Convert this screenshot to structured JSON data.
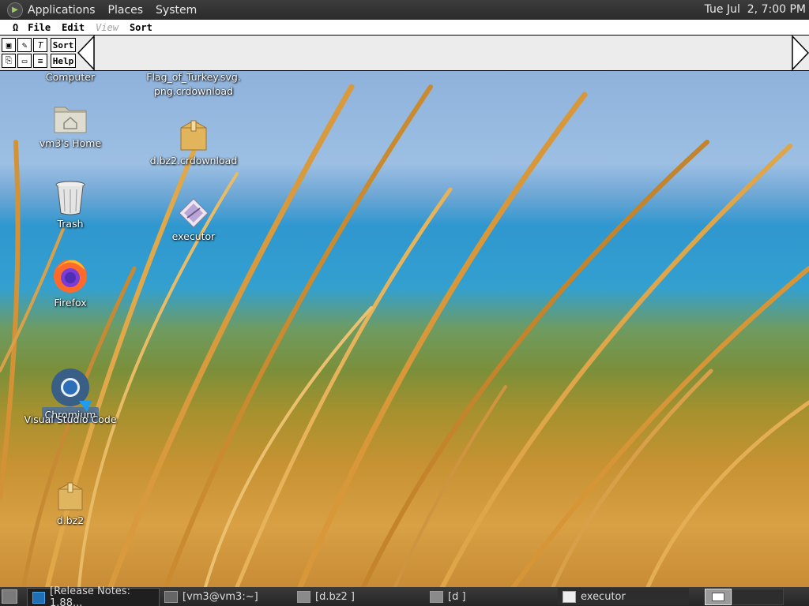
{
  "top_panel": {
    "menus": [
      "Applications",
      "Places",
      "System"
    ],
    "clock": "Tue Jul  2, 7:00 PM"
  },
  "app_menubar": {
    "items": [
      "Ω",
      "File",
      "Edit",
      "View",
      "Sort"
    ],
    "disabled": "View"
  },
  "toolstrip": {
    "sort_label": "Sort",
    "help_label": "Help"
  },
  "desktop": {
    "icons": [
      {
        "label": "Computer",
        "icon": "computer-icon"
      },
      {
        "label": "vm3's Home",
        "icon": "home-folder-icon"
      },
      {
        "label": "Trash",
        "icon": "trash-icon"
      },
      {
        "label": "Firefox",
        "icon": "firefox-icon"
      },
      {
        "label": "Chromium",
        "icon": "chromium-icon"
      },
      {
        "label": "Visual Studio Code",
        "icon": "vscode-icon"
      },
      {
        "label": "d.bz2",
        "icon": "archive-icon"
      },
      {
        "label": "Flag_of_Turkey.svg.",
        "label2": "png.crdownload",
        "icon": "file-icon"
      },
      {
        "label": "d.bz2.crdownload",
        "icon": "archive-icon"
      },
      {
        "label": "executor",
        "icon": "executable-icon"
      }
    ]
  },
  "taskbar": {
    "tasks": [
      {
        "label": "[Release Notes: 1.88...",
        "icon": "vscode-icon"
      },
      {
        "label": "[vm3@vm3:~]",
        "icon": "terminal-icon"
      },
      {
        "label": "[d.bz2 ]",
        "icon": "archive-manager-icon"
      },
      {
        "label": "[d ]",
        "icon": "archive-manager-icon"
      },
      {
        "label": "executor",
        "icon": "window-icon"
      }
    ]
  }
}
